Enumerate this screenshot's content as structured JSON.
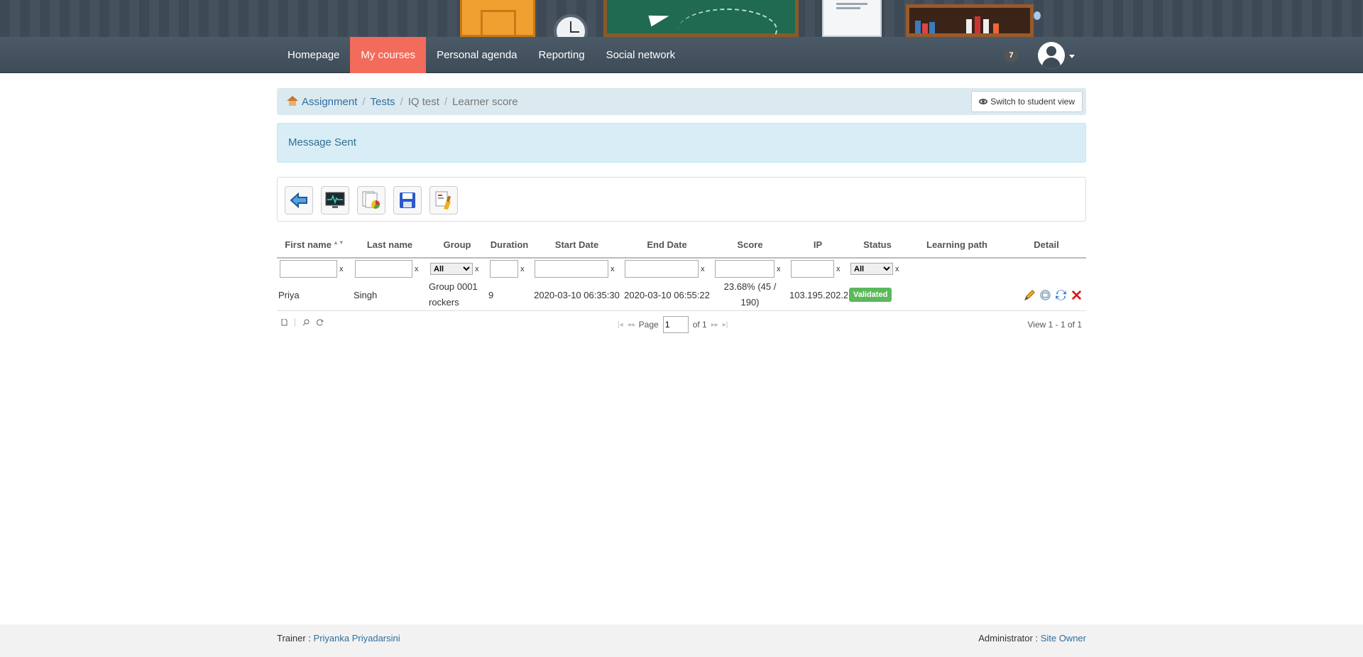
{
  "nav": {
    "items": [
      {
        "label": "Homepage",
        "active": false
      },
      {
        "label": "My courses",
        "active": true
      },
      {
        "label": "Personal agenda",
        "active": false
      },
      {
        "label": "Reporting",
        "active": false
      },
      {
        "label": "Social network",
        "active": false
      }
    ],
    "notification_count": "7",
    "active_color": "#f26b5b"
  },
  "breadcrumb": {
    "items": [
      "Assignment",
      "Tests",
      "IQ test",
      "Learner score"
    ],
    "switch_label": "Switch to student view"
  },
  "alert": {
    "message": "Message Sent"
  },
  "toolbar": {
    "icons": [
      "back-arrow-icon",
      "monitor-pulse-icon",
      "chart-report-icon",
      "save-disk-icon",
      "clean-brush-icon"
    ]
  },
  "grid": {
    "columns": [
      "First name",
      "Last name",
      "Group",
      "Duration",
      "Start Date",
      "End Date",
      "Score",
      "IP",
      "Status",
      "Learning path",
      "Detail"
    ],
    "filter": {
      "clear": "x",
      "select_all": "All"
    },
    "rows": [
      {
        "first_name": "Priya",
        "last_name": "Singh",
        "group": "Group 0001 rockers",
        "duration": "9",
        "start_date": "2020-03-10 06:35:30",
        "end_date": "2020-03-10 06:55:22",
        "score": "23.68% (45 / 190)",
        "ip": "103.195.202.2",
        "status": "Validated",
        "learning_path": ""
      }
    ],
    "pager": {
      "page_label": "Page",
      "page_value": "1",
      "of_label": "of 1",
      "view_label": "View 1 - 1 of 1"
    }
  },
  "footer": {
    "trainer_label": "Trainer : ",
    "trainer_name": "Priyanka Priyadarsini",
    "admin_label": "Administrator : ",
    "admin_name": "Site Owner"
  }
}
